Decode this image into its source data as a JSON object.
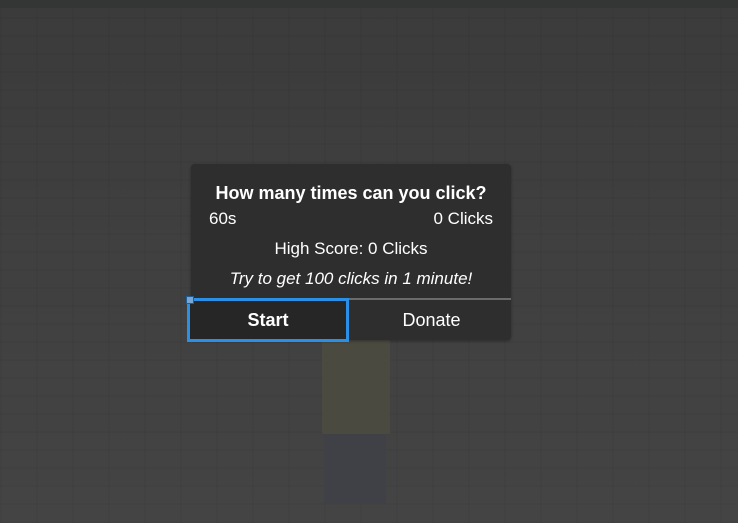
{
  "dialog": {
    "title": "How many times can you click?",
    "timer": "60s",
    "clicks": "0 Clicks",
    "high_score": "High Score: 0 Clicks",
    "hint": "Try to get 100 clicks in 1 minute!"
  },
  "buttons": {
    "start_label": "Start",
    "donate_label": "Donate"
  },
  "colors": {
    "dialog_bg": "#2e2e2e",
    "focus_outline": "#2a8fe6",
    "text": "#ffffff"
  }
}
